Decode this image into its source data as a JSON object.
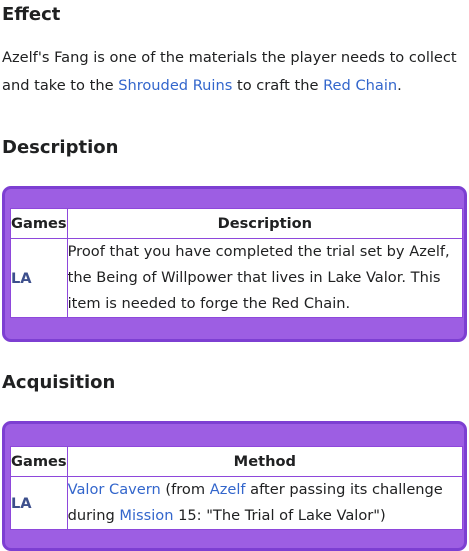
{
  "effect": {
    "heading": "Effect",
    "text_1": "Azelf's Fang is one of the materials the player needs to collect and take to the ",
    "link_1": "Shrouded Ruins",
    "text_2": " to craft the ",
    "link_2": "Red Chain",
    "text_3": "."
  },
  "description": {
    "heading": "Description",
    "columns": [
      "Games",
      "Description"
    ],
    "rows": [
      {
        "game": "LA",
        "text": "Proof that you have completed the trial set by Azelf, the Being of Willpower that lives in Lake Valor. This item is needed to forge the Red Chain."
      }
    ]
  },
  "acquisition": {
    "heading": "Acquisition",
    "columns": [
      "Games",
      "Method"
    ],
    "rows": [
      {
        "game": "LA",
        "link_1": "Valor Cavern",
        "text_1": " (from ",
        "link_2": "Azelf",
        "text_2": " after passing its challenge during ",
        "link_3": "Mission",
        "text_3": " 15: \"The Trial of Lake Valor\")"
      }
    ]
  },
  "colors": {
    "panel_fill": "#9d5ee3",
    "panel_border": "#7d3fd2",
    "link": "#3366cc",
    "game_code": "#3d4f8c"
  }
}
